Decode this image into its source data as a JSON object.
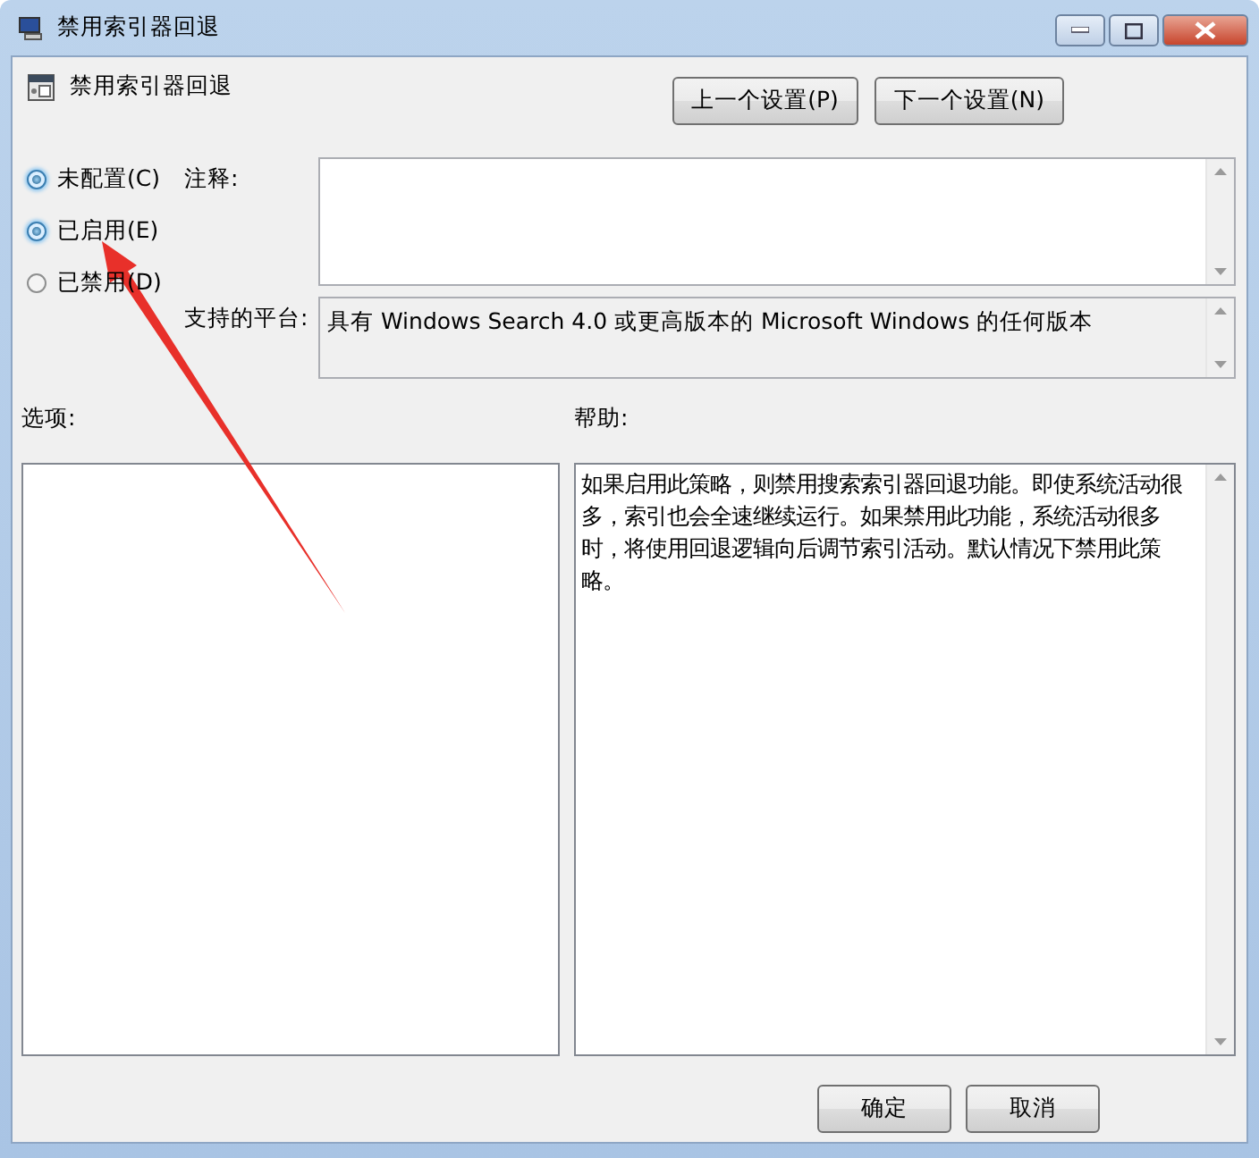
{
  "window": {
    "title": "禁用索引器回退"
  },
  "header": {
    "title": "禁用索引器回退"
  },
  "nav_buttons": [
    "上一个设置(P)",
    "下一个设置(N)"
  ],
  "state_options": [
    {
      "label": "未配置(C)",
      "selected": true
    },
    {
      "label": "已启用(E)",
      "selected": true
    },
    {
      "label": "已禁用(D)",
      "selected": false
    }
  ],
  "comment": {
    "label": "注释:"
  },
  "platform": {
    "label": "支持的平台:",
    "value": "具有 Windows Search 4.0 或更高版本的 Microsoft Windows 的任何版本"
  },
  "options": {
    "label": "选项:"
  },
  "help": {
    "label": "帮助:",
    "text": "如果启用此策略，则禁用搜索索引器回退功能。即使系统活动很多，索引也会全速继续运行。如果禁用此功能，系统活动很多时，将使用回退逻辑向后调节索引活动。默认情况下禁用此策略。"
  },
  "footer_buttons": [
    "确定",
    "取消"
  ]
}
